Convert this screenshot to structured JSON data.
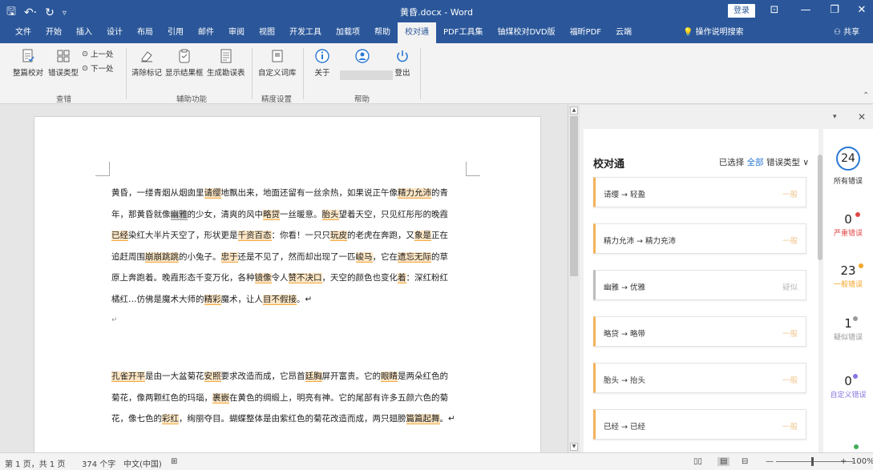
{
  "app": {
    "title": "黄昏.docx  -  Word",
    "login": "登录"
  },
  "menu": {
    "items": [
      "文件",
      "开始",
      "插入",
      "设计",
      "布局",
      "引用",
      "邮件",
      "审阅",
      "视图",
      "开发工具",
      "加载项",
      "帮助",
      "校对通",
      "PDF工具集",
      "铀煤校对DVD版",
      "福昕PDF",
      "云端"
    ],
    "active": "校对通",
    "search": "操作说明搜索",
    "share": "共享"
  },
  "ribbon": {
    "btn_full_check": "整篇校对",
    "btn_error_type": "错误类型",
    "btn_prev": "上一处",
    "btn_next": "下一处",
    "group_check": "查错",
    "btn_clear_marks": "清除标记",
    "btn_show_result": "显示结果框",
    "btn_gen_table": "生成勘误表",
    "group_aux": "辅助功能",
    "btn_custom_dict": "自定义词库",
    "group_precision": "精度设置",
    "btn_about": "关于",
    "btn_logout": "登出",
    "group_help": "帮助"
  },
  "document": {
    "paragraph1": [
      [
        "黄昏，一缕青烟从烟囱里",
        {
          "t": "请缨",
          "c": "o"
        },
        "地飘出来，地面还留有一丝余热，如果说正午像",
        {
          "t": "精力允沛",
          "c": "o"
        },
        "的青"
      ],
      [
        "年，那黄昏就像",
        {
          "t": "幽雅",
          "c": "g"
        },
        "的少女，清爽的风中",
        {
          "t": "略贷",
          "c": "o"
        },
        "一丝暖意。",
        {
          "t": "胎头",
          "c": "o"
        },
        "望着天空，只见红彤彤的晚霞"
      ],
      [
        {
          "t": "已经",
          "c": "o"
        },
        "染红大半片天空了，形状更是",
        {
          "t": "千资百态",
          "c": "o"
        },
        "：你看！一只只",
        {
          "t": "玩皮",
          "c": "o"
        },
        "的老虎在奔跑，又",
        {
          "t": "象是",
          "c": "o"
        },
        "正在"
      ],
      [
        "追赶周围",
        {
          "t": "崩崩跳跳",
          "c": "o"
        },
        "的小兔子。",
        {
          "t": "忠于",
          "c": "o"
        },
        "还是不见了，然而却出现了一匹",
        {
          "t": "峻马",
          "c": "o"
        },
        "，它在",
        {
          "t": "遗忘无际",
          "c": "o"
        },
        "的草"
      ],
      [
        "原上奔跑着。晚霞形态千变万化，各种",
        {
          "t": "镜像",
          "c": "o"
        },
        "令人",
        {
          "t": "赞不决口",
          "c": "o"
        },
        "，天空的颜色也变化",
        {
          "t": "着",
          "c": "o"
        },
        "：深红粉红"
      ],
      [
        "橘红…仿佛是魔术大师的",
        {
          "t": "精彩",
          "c": "o"
        },
        "魔术，让人",
        {
          "t": "目不假接",
          "c": "o"
        },
        "。↵"
      ]
    ],
    "empty_line": "↵",
    "paragraph2": [
      [
        {
          "t": "孔雀开平",
          "c": "o"
        },
        "是由一大盆菊花",
        {
          "t": "安照",
          "c": "o"
        },
        "要求改造而成，它昂首",
        {
          "t": "廷胸",
          "c": "o"
        },
        "屏开富贵。它的",
        {
          "t": "眼睛",
          "c": "o"
        },
        "是两朵红色的"
      ],
      [
        "菊花，像两颗红色的玛瑙，",
        {
          "t": "裹嵌",
          "c": "o"
        },
        "在黄色的绸缎上，明亮有神。它的尾部有许多五颜六色的菊"
      ],
      [
        "花，像七色的",
        {
          "t": "彩红",
          "c": "o"
        },
        "，绚丽夺目。蝴蝶整体是由紫红色的菊花改造而成，两只翅膀",
        {
          "t": "篇篇起舞",
          "c": "o"
        },
        "。↵"
      ]
    ]
  },
  "pane": {
    "title": "校对通",
    "filter_prefix": "已选择",
    "filter_all": "全部",
    "filter_suffix": "错误类型",
    "cards": [
      {
        "from": "请缨",
        "to": "轻盈",
        "level": "一般",
        "kind": "general"
      },
      {
        "from": "精力允沛",
        "to": "精力充沛",
        "level": "一般",
        "kind": "general"
      },
      {
        "from": "幽雅",
        "to": "优雅",
        "level": "疑似",
        "kind": "suspect"
      },
      {
        "from": "略贷",
        "to": "略带",
        "level": "一般",
        "kind": "general"
      },
      {
        "from": "胎头",
        "to": "抬头",
        "level": "一般",
        "kind": "general"
      },
      {
        "from": "已经",
        "to": "已经",
        "level": "一般",
        "kind": "general"
      }
    ],
    "stats": {
      "total": "24",
      "total_label": "所有错误",
      "severe": "0",
      "severe_label": "严重错误",
      "general": "23",
      "general_label": "一般错误",
      "suspect": "1",
      "suspect_label": "疑似错误",
      "custom": "0",
      "custom_label": "自定义错误"
    },
    "colors": {
      "severe": "#e04848",
      "general": "#f4a62a",
      "suspect": "#9a9a9a",
      "custom": "#8a76e0",
      "accent": "#2b78d4"
    }
  },
  "status": {
    "page": "第 1 页，共 1 页",
    "words": "374 个字",
    "lang": "中文(中国)",
    "zoom": "100%"
  }
}
